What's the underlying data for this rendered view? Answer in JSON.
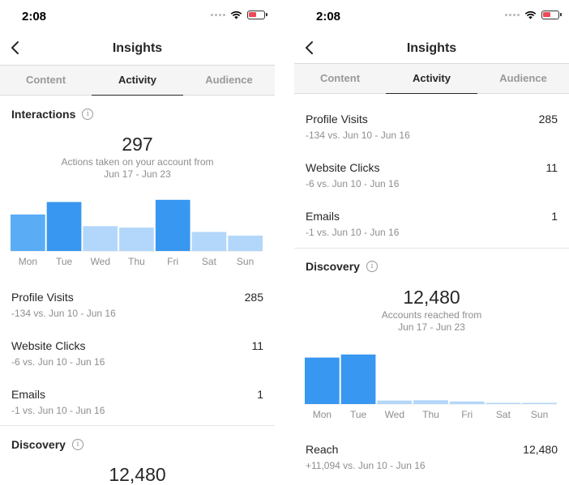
{
  "left": {
    "status": {
      "time": "2:08"
    },
    "nav_title": "Insights",
    "tabs": [
      {
        "label": "Content",
        "active": false
      },
      {
        "label": "Activity",
        "active": true
      },
      {
        "label": "Audience",
        "active": false
      }
    ],
    "interactions": {
      "title": "Interactions",
      "total": "297",
      "caption_line1": "Actions taken on your account from",
      "caption_line2": "Jun 17 - Jun 23"
    },
    "metrics": [
      {
        "name": "Profile Visits",
        "value": "285",
        "compare": "-134 vs. Jun 10 - Jun 16"
      },
      {
        "name": "Website Clicks",
        "value": "11",
        "compare": "-6 vs. Jun 10 - Jun 16"
      },
      {
        "name": "Emails",
        "value": "1",
        "compare": "-1 vs. Jun 10 - Jun 16"
      }
    ],
    "discovery": {
      "title": "Discovery",
      "total": "12,480"
    }
  },
  "right": {
    "status": {
      "time": "2:08"
    },
    "nav_title": "Insights",
    "tabs": [
      {
        "label": "Content",
        "active": false
      },
      {
        "label": "Activity",
        "active": true
      },
      {
        "label": "Audience",
        "active": false
      }
    ],
    "metrics": [
      {
        "name": "Profile Visits",
        "value": "285",
        "compare": "-134 vs. Jun 10 - Jun 16"
      },
      {
        "name": "Website Clicks",
        "value": "11",
        "compare": "-6 vs. Jun 10 - Jun 16"
      },
      {
        "name": "Emails",
        "value": "1",
        "compare": "-1 vs. Jun 10 - Jun 16"
      }
    ],
    "discovery": {
      "title": "Discovery",
      "total": "12,480",
      "caption_line1": "Accounts reached from",
      "caption_line2": "Jun 17 - Jun 23"
    },
    "reach": {
      "name": "Reach",
      "value": "12,480",
      "compare": "+11,094 vs. Jun 10 - Jun 16"
    }
  },
  "colors": {
    "bar_dark": "#3897f0",
    "bar_mid": "#5aacf5",
    "bar_light": "#b3d7fa",
    "divider": "#e6e6e6"
  },
  "chart_data": [
    {
      "type": "bar",
      "title": "Interactions",
      "categories": [
        "Mon",
        "Tue",
        "Wed",
        "Thu",
        "Fri",
        "Sat",
        "Sun"
      ],
      "values": [
        50,
        67,
        34,
        32,
        70,
        26,
        21
      ],
      "tones": [
        "mid",
        "dark",
        "light",
        "light",
        "dark",
        "light",
        "light"
      ],
      "ylim": [
        0,
        72
      ]
    },
    {
      "type": "bar",
      "title": "Discovery",
      "categories": [
        "Mon",
        "Tue",
        "Wed",
        "Thu",
        "Fri",
        "Sat",
        "Sun"
      ],
      "values": [
        5300,
        5650,
        400,
        430,
        300,
        120,
        100
      ],
      "tones": [
        "dark",
        "dark",
        "light",
        "light",
        "light",
        "light",
        "light"
      ],
      "ylim": [
        0,
        6000
      ]
    }
  ]
}
